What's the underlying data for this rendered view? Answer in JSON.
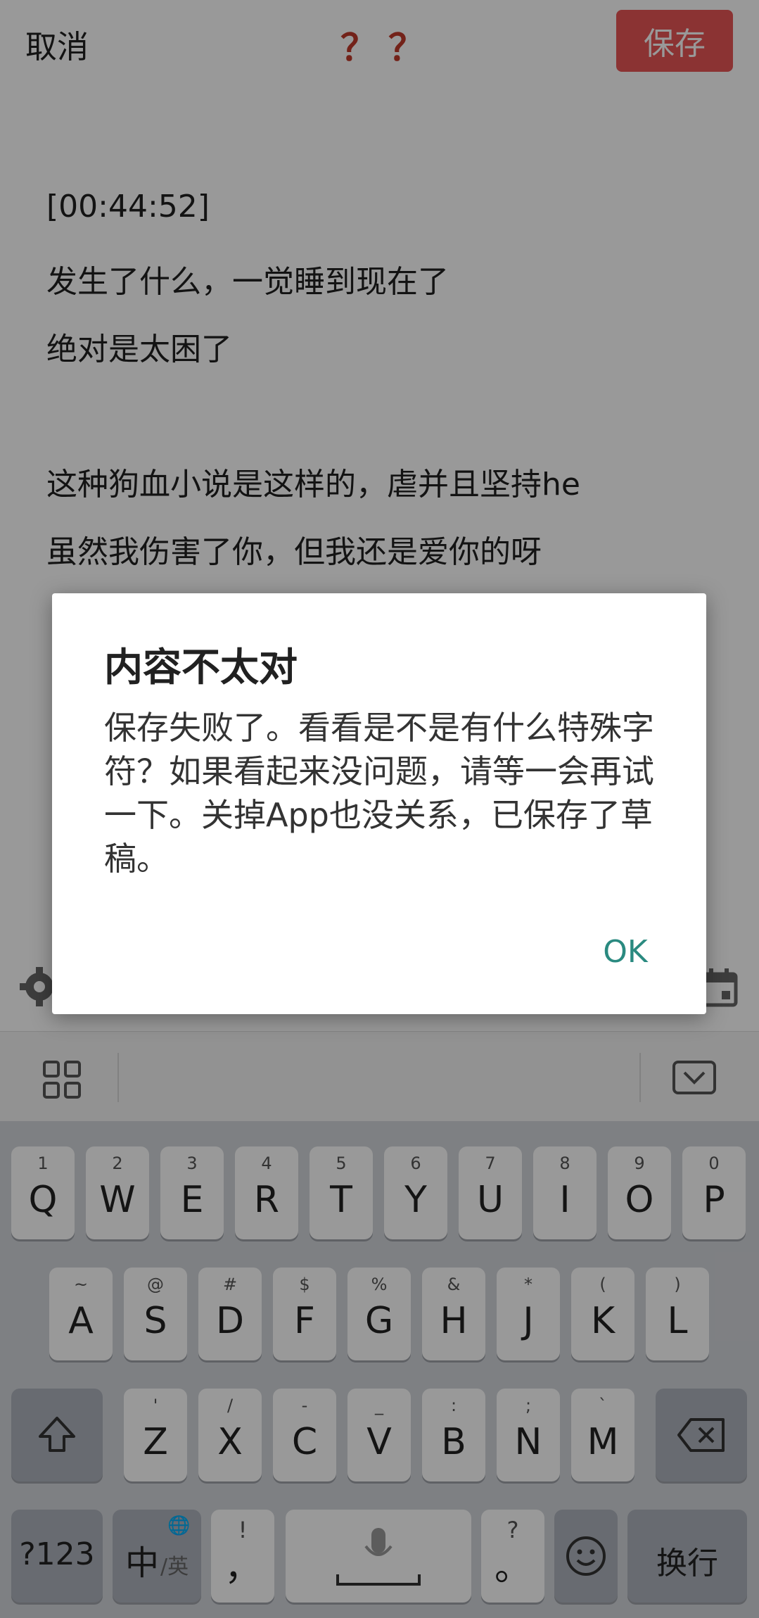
{
  "topbar": {
    "cancel": "取消",
    "title": "？？",
    "save": "保存"
  },
  "content": {
    "lines": [
      "[00:44:52]",
      "发生了什么，一觉睡到现在了",
      "绝对是太困了",
      "这种狗血小说是这样的，虐并且坚持he",
      "虽然我伤害了你，但我还是爱你的呀"
    ]
  },
  "dialog": {
    "title": "内容不太对",
    "message": "保存失败了。看看是不是有什么特殊字符？如果看起来没问题，请等一会再试一下。关掉App也没关系，已保存了草稿。",
    "ok": "OK"
  },
  "keyboard": {
    "row1": {
      "labels": [
        "Q",
        "W",
        "E",
        "R",
        "T",
        "Y",
        "U",
        "I",
        "O",
        "P"
      ],
      "nums": [
        "1",
        "2",
        "3",
        "4",
        "5",
        "6",
        "7",
        "8",
        "9",
        "0"
      ]
    },
    "row2": {
      "labels": [
        "A",
        "S",
        "D",
        "F",
        "G",
        "H",
        "J",
        "K",
        "L"
      ],
      "syms": [
        "~",
        "@",
        "#",
        "$",
        "%",
        "&",
        "*",
        "(",
        ")"
      ]
    },
    "row3": {
      "labels": [
        "Z",
        "X",
        "C",
        "V",
        "B",
        "N",
        "M"
      ],
      "syms": [
        "'",
        "/",
        "-",
        "_",
        ":",
        ";",
        "`"
      ]
    },
    "mode": "?123",
    "lang": "中",
    "lang_sub": "/英",
    "comma": "，",
    "comma_sub": "!",
    "period": "。",
    "period_sub": "?",
    "enter": "换行"
  },
  "colors": {
    "accent": "#2a8a80",
    "save": "#e85555"
  }
}
